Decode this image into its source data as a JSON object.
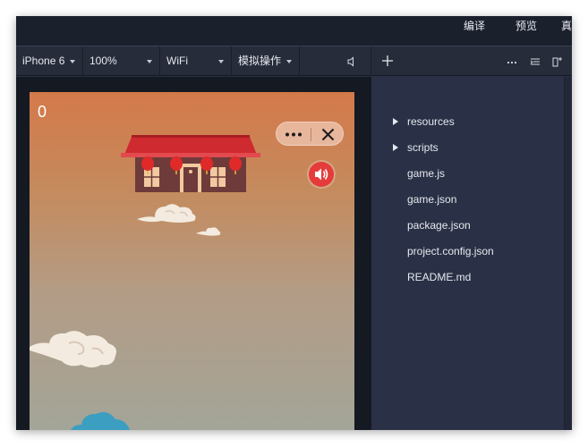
{
  "menubar": {
    "compile": "编译",
    "preview": "预览",
    "real_device": "真"
  },
  "toolbar": {
    "device": "iPhone 6",
    "zoom": "100%",
    "network": "WiFi",
    "simulate": "模拟操作",
    "icons": [
      "more-icon",
      "format-icon",
      "split-icon"
    ]
  },
  "simulator": {
    "score": "0",
    "colors": {
      "sky_top": "#d4794a",
      "sky_bottom": "#a3a598",
      "roof": "#cf2a30",
      "wall": "#6e3b3a",
      "lantern": "#e02a2a",
      "sound_button": "#e53b3b"
    }
  },
  "file_tree": {
    "items": [
      {
        "label": "resources",
        "type": "folder"
      },
      {
        "label": "scripts",
        "type": "folder"
      },
      {
        "label": "game.js",
        "type": "file"
      },
      {
        "label": "game.json",
        "type": "file"
      },
      {
        "label": "package.json",
        "type": "file"
      },
      {
        "label": "project.config.json",
        "type": "file"
      },
      {
        "label": "README.md",
        "type": "file"
      }
    ]
  }
}
